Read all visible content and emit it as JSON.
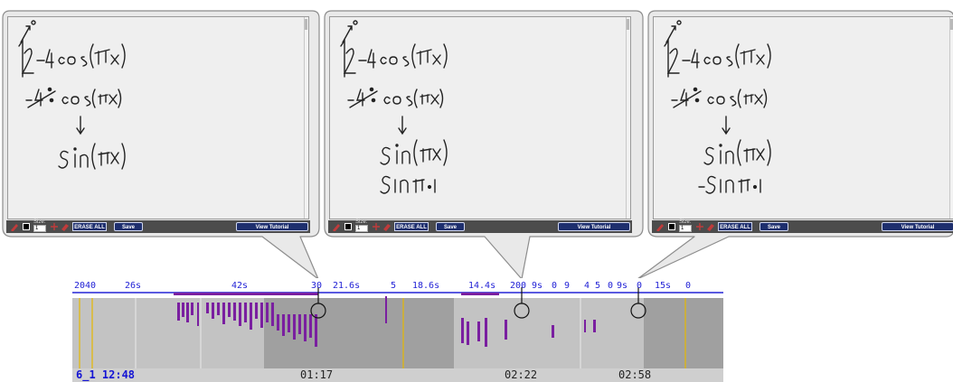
{
  "panels": [
    {
      "size_label": "Size:",
      "size_value": "1",
      "erase_all": "ERASE ALL",
      "save": "Save",
      "view_tutorial": "View Tutorial"
    },
    {
      "size_label": "Size:",
      "size_value": "1",
      "erase_all": "ERASE ALL",
      "save": "Save",
      "view_tutorial": "View Tutorial"
    },
    {
      "size_label": "Size:",
      "size_value": "1",
      "erase_all": "ERASE ALL",
      "save": "Save",
      "view_tutorial": "View Tutorial"
    }
  ],
  "handwriting": {
    "line1": "12 - 4cos(πx)",
    "line2": "-4 · cos(πx)",
    "line3": "↓",
    "line4": "sin(πx)",
    "line5_panel2": "sin π·1",
    "line5_panel3": "-sin π·1"
  },
  "timeline": {
    "top_labels": [
      "204",
      "0",
      "26s",
      "42s",
      "30",
      "21.6s",
      "5",
      "18.6s",
      "14.4s",
      "200",
      "9s",
      "0",
      "9",
      "4",
      "5",
      "0",
      "9s",
      "0",
      "15s",
      "0"
    ],
    "bottom": {
      "stamp": "6_1 12:48",
      "t1": "01:17",
      "t2": "02:22",
      "t3": "02:58"
    },
    "colors": {
      "axis": "#2323d6",
      "bars": "#7a1fa0",
      "marker": "#e6b800",
      "bg_light": "#c3c3c3",
      "bg_dark": "#9f9f9f"
    }
  }
}
